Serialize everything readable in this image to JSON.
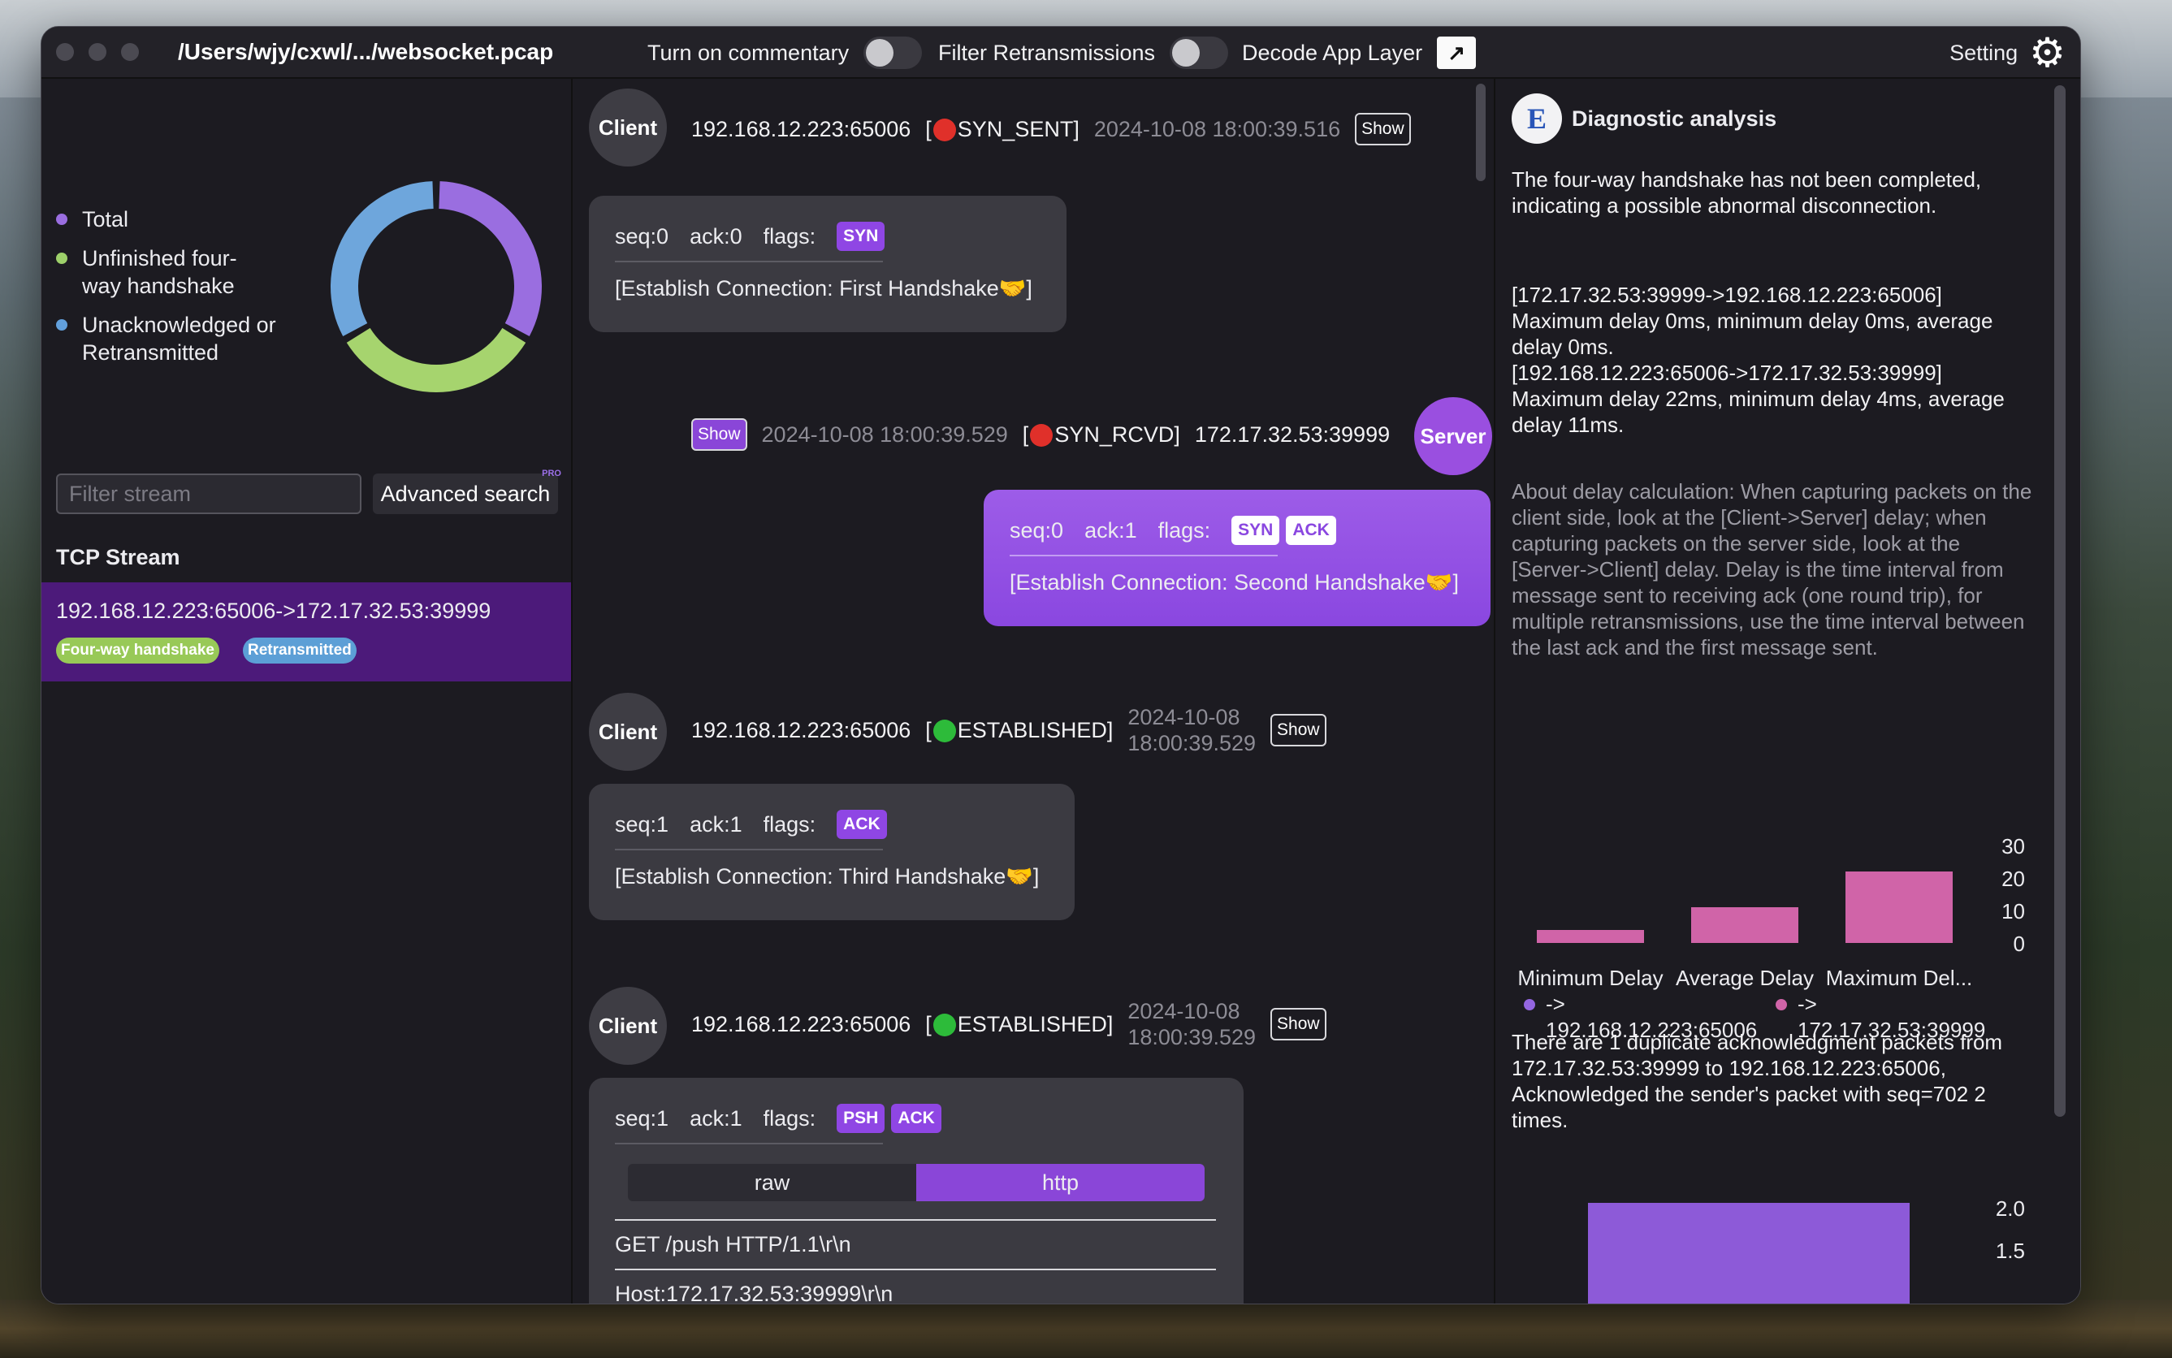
{
  "titlebar": {
    "file_path": "/Users/wjy/cxwl/.../websocket.pcap",
    "commentary_label": "Turn on commentary",
    "filter_retrans_label": "Filter Retransmissions",
    "decode_label": "Decode App Layer",
    "decode_icon": "↗",
    "setting_label": "Setting",
    "gear_icon": "⚙"
  },
  "sidebar": {
    "legend": [
      {
        "label": "Total",
        "color": "#9a6ee0"
      },
      {
        "label": "Unfinished four-way handshake",
        "color": "#9dd06a"
      },
      {
        "label": "Unacknowledged or Retransmitted",
        "color": "#62a0dc"
      }
    ],
    "donut": [
      {
        "name": "Total",
        "value": 1,
        "color": "#9a6ee0"
      },
      {
        "name": "Unfinished four-way handshake",
        "value": 1,
        "color": "#a6d46e"
      },
      {
        "name": "Unacknowledged or Retransmitted",
        "value": 1,
        "color": "#6ea6dc"
      }
    ],
    "filter_placeholder": "Filter stream",
    "advanced_search_label": "Advanced search",
    "pro_badge": "PRO",
    "tcp_stream_title": "TCP Stream",
    "stream": {
      "addr": "192.168.12.223:65006->172.17.32.53:39999",
      "tag_handshake": "Four-way handshake",
      "tag_retrans": "Retransmitted"
    }
  },
  "packets": [
    {
      "role": "Client",
      "addr": "192.168.12.223:65006",
      "state": "SYN_SENT",
      "state_color": "#e0302a",
      "time": "2024-10-08 18:00:39.516",
      "show": "Show",
      "seq": "seq:0",
      "ack": "ack:0",
      "flags_label": "flags:",
      "flags": [
        "SYN"
      ],
      "note": "[Establish Connection: First Handshake🤝]"
    },
    {
      "role": "Server",
      "addr": "172.17.32.53:39999",
      "state": "SYN_RCVD",
      "state_color": "#e0302a",
      "time": "2024-10-08 18:00:39.529",
      "show": "Show",
      "seq": "seq:0",
      "ack": "ack:1",
      "flags_label": "flags:",
      "flags": [
        "SYN",
        "ACK"
      ],
      "note": "[Establish Connection: Second Handshake🤝]"
    },
    {
      "role": "Client",
      "addr": "192.168.12.223:65006",
      "state": "ESTABLISHED",
      "state_color": "#2dbb3a",
      "date": "2024-10-08",
      "clock": "18:00:39.529",
      "show": "Show",
      "seq": "seq:1",
      "ack": "ack:1",
      "flags_label": "flags:",
      "flags": [
        "ACK"
      ],
      "note": "[Establish Connection: Third Handshake🤝]"
    },
    {
      "role": "Client",
      "addr": "192.168.12.223:65006",
      "state": "ESTABLISHED",
      "state_color": "#2dbb3a",
      "date": "2024-10-08",
      "clock": "18:00:39.529",
      "show": "Show",
      "seq": "seq:1",
      "ack": "ack:1",
      "flags_label": "flags:",
      "flags": [
        "PSH",
        "ACK"
      ],
      "tabs": [
        "raw",
        "http"
      ],
      "active_tab": "http",
      "http_lines": [
        "GET /push HTTP/1.1\\r\\n",
        "Host:172.17.32.53:39999\\r\\n"
      ]
    }
  ],
  "diagnostic": {
    "title": "Diagnostic analysis",
    "logo_letter": "E",
    "summary": "The four-way handshake has not been completed, indicating a possible abnormal disconnection.",
    "delay_c2s_addr": "[172.17.32.53:39999->192.168.12.223:65006]",
    "delay_c2s": "Maximum delay 0ms, minimum delay 0ms, average delay 0ms.",
    "delay_s2c_addr": "[192.168.12.223:65006->172.17.32.53:39999]",
    "delay_s2c": "Maximum delay 22ms, minimum delay 4ms, average delay 11ms.",
    "about": "About delay calculation: When capturing packets on the client side, look at the [Client->Server] delay; when capturing packets on the server side, look at the [Server->Client] delay. Delay is the time interval from message sent to receiving ack (one round trip), for multiple retransmissions, use the time interval between the last ack and the first message sent.",
    "dup_ack": "There are 1 duplicate acknowledgment packets from 172.17.32.53:39999 to 192.168.12.223:65006, Acknowledged the sender's packet with seq=702 2 times."
  },
  "chart_data": [
    {
      "type": "bar",
      "categories": [
        "Minimum Delay",
        "Average Delay",
        "Maximum Del..."
      ],
      "series": [
        {
          "name": "-> 192.168.12.223:65006",
          "color": "#9466e0",
          "values": [
            0,
            0,
            0
          ]
        },
        {
          "name": "-> 172.17.32.53:39999",
          "color": "#d064a8",
          "values": [
            4,
            11,
            22
          ]
        }
      ],
      "yticks": [
        0,
        10,
        20,
        30
      ],
      "ylim": [
        0,
        30
      ],
      "axis_side": "right",
      "legend_position": "bottom"
    },
    {
      "type": "bar",
      "categories": [
        ""
      ],
      "series": [
        {
          "name": "",
          "color": "#8d5ad8",
          "values": [
            2
          ]
        }
      ],
      "yticks": [
        1.5,
        2.0
      ],
      "ytick_labels": [
        "1.5",
        "2.0"
      ],
      "ylim": [
        0,
        2.0
      ],
      "axis_side": "right"
    }
  ]
}
